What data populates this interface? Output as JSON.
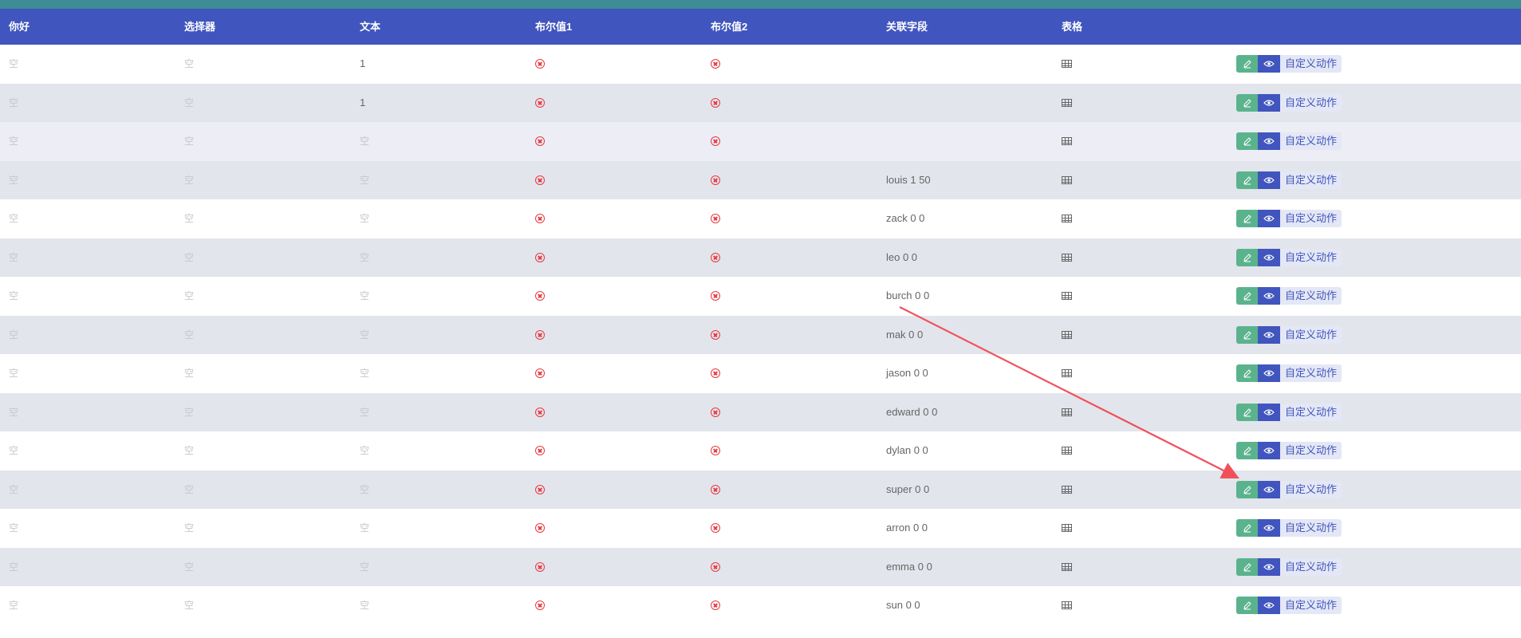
{
  "headers": [
    "你好",
    "选择器",
    "文本",
    "布尔值1",
    "布尔值2",
    "关联字段",
    "表格",
    ""
  ],
  "empty_label": "空",
  "action_label": "自定义动作",
  "rows": [
    {
      "c1": "空",
      "c2": "空",
      "c3": "1",
      "rel": ""
    },
    {
      "c1": "空",
      "c2": "空",
      "c3": "1",
      "rel": ""
    },
    {
      "c1": "空",
      "c2": "空",
      "c3": "空",
      "rel": ""
    },
    {
      "c1": "空",
      "c2": "空",
      "c3": "空",
      "rel": "louis 1 50"
    },
    {
      "c1": "空",
      "c2": "空",
      "c3": "空",
      "rel": "zack 0 0"
    },
    {
      "c1": "空",
      "c2": "空",
      "c3": "空",
      "rel": "leo 0 0"
    },
    {
      "c1": "空",
      "c2": "空",
      "c3": "空",
      "rel": "burch 0 0"
    },
    {
      "c1": "空",
      "c2": "空",
      "c3": "空",
      "rel": "mak 0 0"
    },
    {
      "c1": "空",
      "c2": "空",
      "c3": "空",
      "rel": "jason 0 0"
    },
    {
      "c1": "空",
      "c2": "空",
      "c3": "空",
      "rel": "edward 0 0"
    },
    {
      "c1": "空",
      "c2": "空",
      "c3": "空",
      "rel": "dylan 0 0"
    },
    {
      "c1": "空",
      "c2": "空",
      "c3": "空",
      "rel": "super 0 0"
    },
    {
      "c1": "空",
      "c2": "空",
      "c3": "空",
      "rel": "arron 0 0"
    },
    {
      "c1": "空",
      "c2": "空",
      "c3": "空",
      "rel": "emma 0 0"
    },
    {
      "c1": "空",
      "c2": "空",
      "c3": "空",
      "rel": "sun 0 0"
    }
  ],
  "icons": {
    "bool_false": "circle-x-icon",
    "table": "table-grid-icon",
    "edit": "pencil-icon",
    "view": "eye-icon"
  },
  "colors": {
    "header_bg": "#4055bd",
    "top_strip": "#3d8c93",
    "false_icon": "#e8383d",
    "edit_button": "#5bb38d",
    "view_button": "#4055bd",
    "annotation_arrow": "#f0505a"
  }
}
